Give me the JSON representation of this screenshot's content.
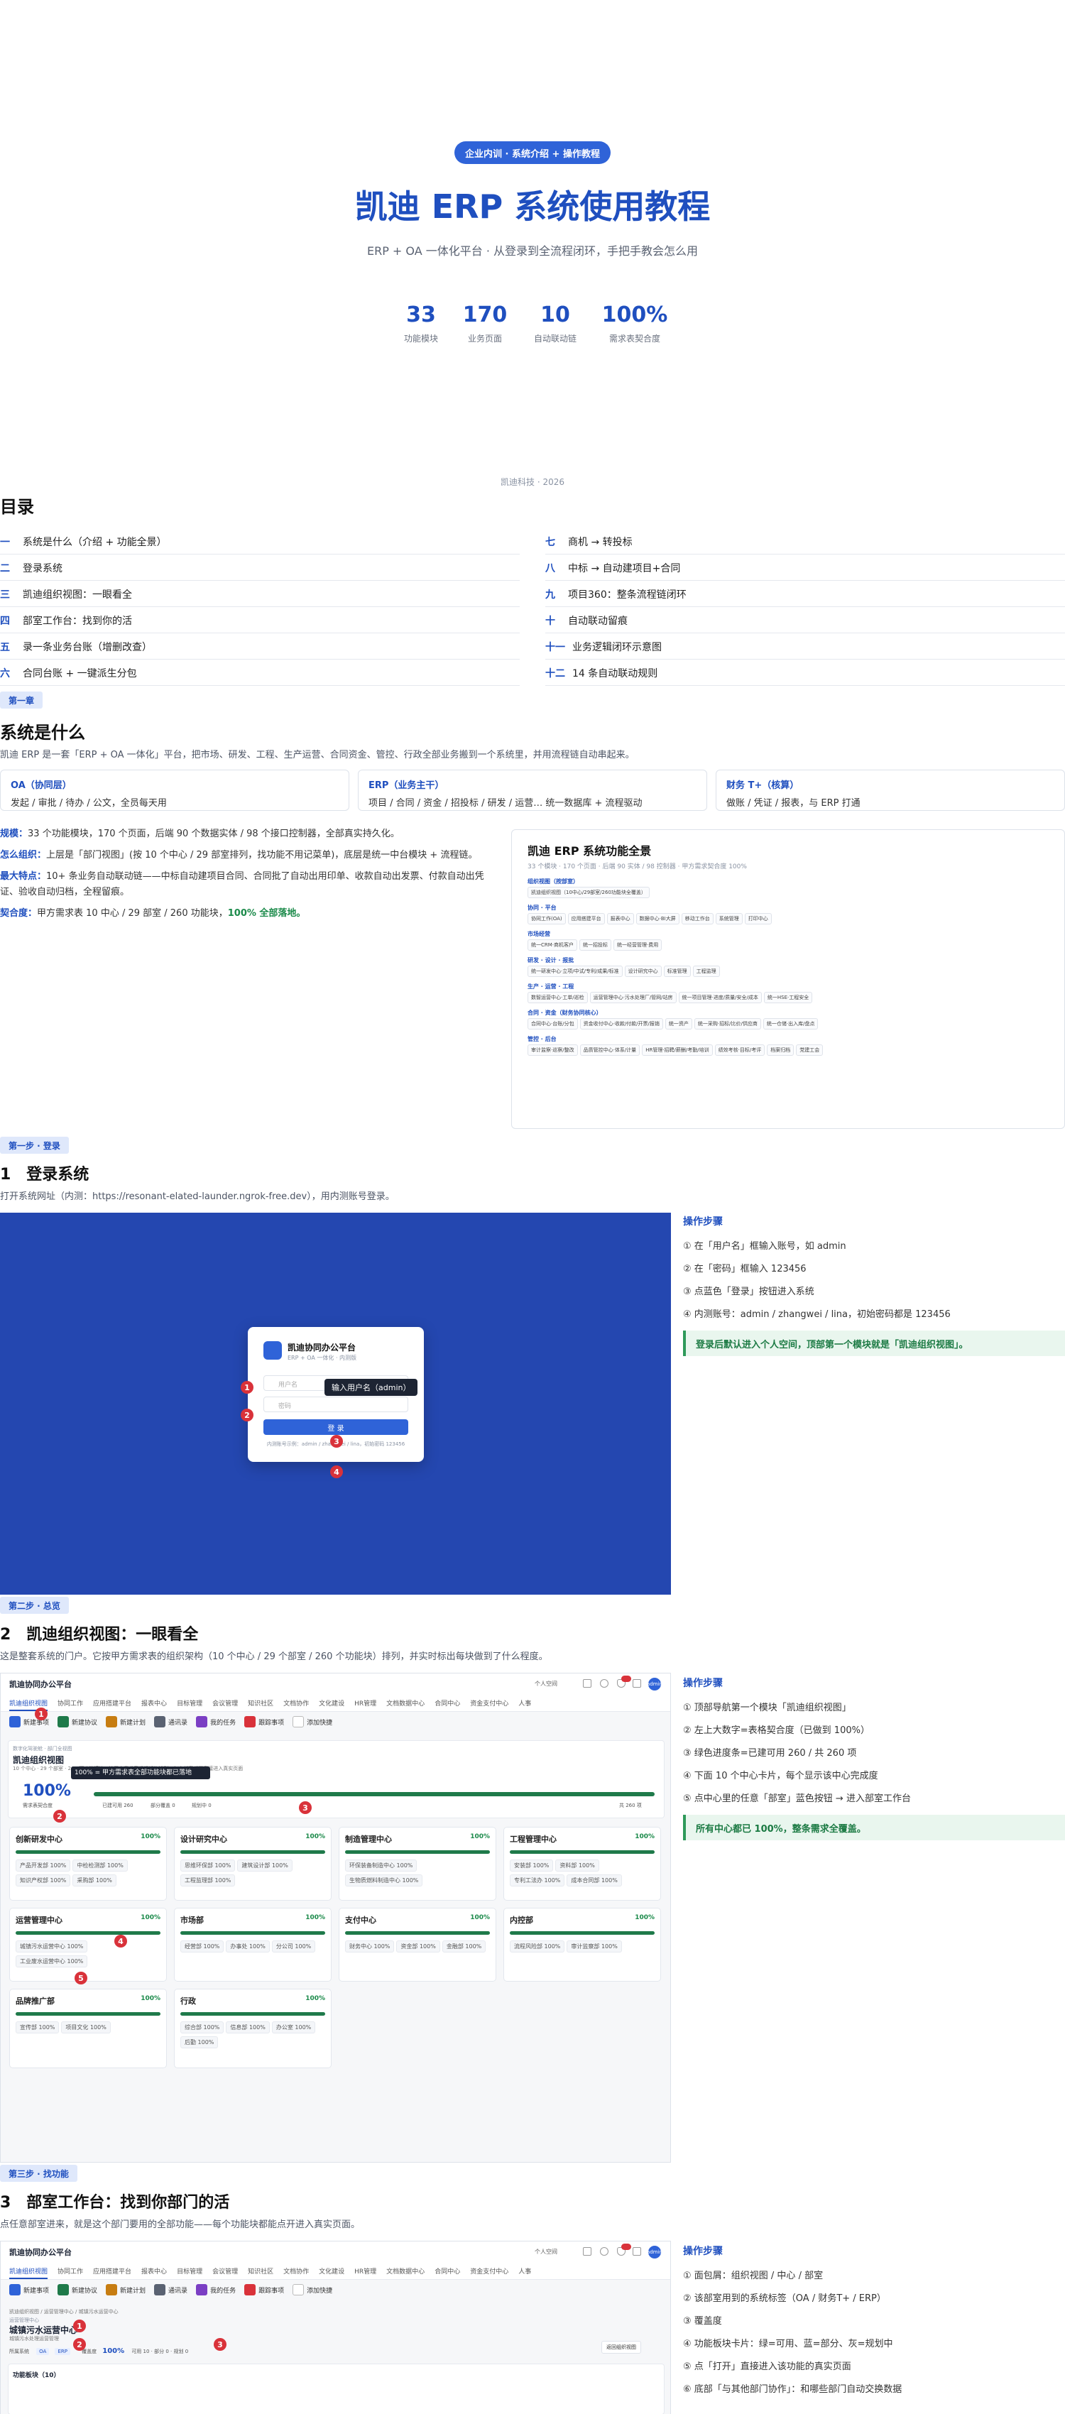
{
  "cover": {
    "tag": "企业内训 · 系统介绍 + 操作教程",
    "title": "凯迪 ERP 系统使用教程",
    "subtitle": "ERP + OA 一体化平台 · 从登录到全流程闭环，手把手教会怎么用",
    "stats": [
      {
        "num": "33",
        "label": "功能模块"
      },
      {
        "num": "170",
        "label": "业务页面"
      },
      {
        "num": "10",
        "label": "自动联动链"
      },
      {
        "num": "100%",
        "label": "需求表契合度"
      }
    ],
    "footer": "凯迪科技 · 2026"
  },
  "toc": {
    "title": "目录",
    "left": [
      {
        "no": "一",
        "text": "系统是什么（介绍 + 功能全景）"
      },
      {
        "no": "二",
        "text": "登录系统"
      },
      {
        "no": "三",
        "text": "凯迪组织视图：一眼看全"
      },
      {
        "no": "四",
        "text": "部室工作台：找到你的活"
      },
      {
        "no": "五",
        "text": "录一条业务台账（增删改查）"
      },
      {
        "no": "六",
        "text": "合同台账 + 一键派生分包"
      }
    ],
    "right": [
      {
        "no": "七",
        "text": "商机 → 转投标"
      },
      {
        "no": "八",
        "text": "中标 → 自动建项目+合同"
      },
      {
        "no": "九",
        "text": "项目360：整条流程链闭环"
      },
      {
        "no": "十",
        "text": "自动联动留痕"
      },
      {
        "no": "十一",
        "text": "业务逻辑闭环示意图"
      },
      {
        "no": "十二",
        "text": "14 条自动联动规则"
      }
    ]
  },
  "ch1": {
    "chip": "第一章",
    "title": "系统是什么",
    "intro": "凯迪 ERP 是一套「ERP + OA 一体化」平台，把市场、研发、工程、生产运营、合同资金、管控、行政全部业务搬到一个系统里，并用流程链自动串起来。",
    "cards": [
      {
        "title": "OA（协同层）",
        "desc": "发起 / 审批 / 待办 / 公文，全员每天用"
      },
      {
        "title": "ERP（业务主干）",
        "desc": "项目 / 合同 / 资金 / 招投标 / 研发 / 运营… 统一数据库 + 流程驱动"
      },
      {
        "title": "财务 T+（核算）",
        "desc": "做账 / 凭证 / 报表，与 ERP 打通"
      }
    ],
    "scale_k": "规模：",
    "scale_v": "33 个功能模块，170 个页面，后端 90 个数据实体 / 98 个接口控制器，全部真实持久化。",
    "org_k": "怎么组织：",
    "org_v": "上层是「部门视图」(按 10 个中心 / 29 部室排列，找功能不用记菜单)，底层是统一中台模块 + 流程链。",
    "feat_k": "最大特点：",
    "feat_v": "10+ 条业务自动联动链——中标自动建项目合同、合同批了自动出用印单、收款自动出发票、付款自动出凭证、验收自动归档，全程留痕。",
    "fit_k": "契合度：",
    "fit_v": "甲方需求表 10 中心 / 29 部室 / 260 功能块，",
    "fit_ok": "100% 全部落地。"
  },
  "panorama": {
    "title": "凯迪 ERP 系统功能全景",
    "meta": "33 个模块 · 170 个页面 · 后端 90 实体 / 98 控制器 · 甲方需求契合度 100%",
    "groups": [
      {
        "name": "组织视图（按部室）",
        "tags": [
          "凯迪组织视图（10中心/29部室/260功能块全覆盖）"
        ]
      },
      {
        "name": "协同 · 平台",
        "tags": [
          "协同工作(OA)",
          "应用搭建平台",
          "报表中心",
          "数据中心·BI大屏",
          "移动工作台",
          "系统管理",
          "打印中心"
        ]
      },
      {
        "name": "市场经营",
        "tags": [
          "统一CRM·商机客户",
          "统一招投标",
          "统一经营管理·费用"
        ]
      },
      {
        "name": "研发 · 设计 · 报批",
        "tags": [
          "统一研发中心·立项/中试/专利/成果/标准",
          "设计研究中心",
          "标准管理",
          "工程监理"
        ]
      },
      {
        "name": "生产 · 运营 · 工程",
        "tags": [
          "数智运营中心·工单/巡检",
          "运营管理中心·污水处理厂/管网/站房",
          "统一项目管理·进度/质量/安全/成本",
          "统一HSE·工程安全"
        ]
      },
      {
        "name": "合同 · 资金（财务协同核心）",
        "tags": [
          "合同中心·台账/分包",
          "资金收付中心·收款/付款/开票/报销",
          "统一资产",
          "统一采购·招标/比价/供应商",
          "统一仓储·出入库/盘点"
        ]
      },
      {
        "name": "管控 · 后台",
        "tags": [
          "审计监察·巡察/整改",
          "品质管控中心·体系/计量",
          "HR管理·招聘/薪酬/考勤/培训",
          "绩效考核·目标/考评",
          "档案归档",
          "党建工会"
        ]
      }
    ]
  },
  "step1": {
    "chip": "第一步 · 登录",
    "title": "1　登录系统",
    "desc": "打开系统网址（内测：https://resonant-elated-launder.ngrok-free.dev），用内测账号登录。",
    "login": {
      "app": "凯迪协同办公平台",
      "app_sub": "ERP + OA 一体化 · 内测版",
      "user_ph": "用户名",
      "pwd_ph": "密码",
      "btn": "登 录",
      "hint": "内测账号示例：admin / zhangwei / lina，初始密码 123456",
      "tooltip": "输入用户名（admin）"
    },
    "steps_title": "操作步骤",
    "steps": [
      "① 在「用户名」框输入账号，如 admin",
      "② 在「密码」框输入 123456",
      "③ 点蓝色「登录」按钮进入系统",
      "④ 内测账号：admin / zhangwei / lina，初始密码都是 123456"
    ],
    "note": "登录后默认进入个人空间，顶部第一个模块就是「凯迪组织视图」。"
  },
  "step2": {
    "chip": "第二步 · 总览",
    "title": "2　凯迪组织视图：一眼看全",
    "desc": "这是整套系统的门户。它按甲方需求表的组织架构（10 个中心 / 29 个部室 / 260 个功能块）排列，并实时标出每块做到了什么程度。",
    "app": "凯迪协同办公平台",
    "top_right": "个人空间",
    "avatar": "admin",
    "tabs": [
      "凯迪组织视图",
      "协同工作",
      "应用搭建平台",
      "报表中心",
      "目标管理",
      "会议管理",
      "知识社区",
      "文档协作",
      "文化建设",
      "HR管理",
      "文档数据中心",
      "合同中心",
      "资金支付中心",
      "人事"
    ],
    "quick": [
      "新建事项",
      "新建协议",
      "新建计划",
      "通讯录",
      "我的任务",
      "跟踪事项",
      "添加快捷"
    ],
    "crumb": "数字化驾驶舱 · 部门全视图",
    "view_title": "凯迪组织视图",
    "view_desc": "10 个中心 · 29 个部室 · 260 项功能模块，按甲方需求表组织架构排列，每个部室都可直接进入真实页面",
    "pct": "100%",
    "pct_label": "需求表契合度",
    "done_label": "已建可用 260",
    "partial_label": "部分覆盖 0",
    "plan_label": "规划中 0",
    "total_label": "共 260 项",
    "tooltip": "100% = 甲方需求表全部功能块都已落地",
    "depts": [
      {
        "name": "创新研发中心",
        "pct": "100%",
        "subs": [
          "产品开发部 100%",
          "中检检测部 100%",
          "知识产权部 100%",
          "采购部 100%"
        ]
      },
      {
        "name": "设计研究中心",
        "pct": "100%",
        "subs": [
          "思维环保部 100%",
          "建筑设计部 100%",
          "工程监理部 100%"
        ]
      },
      {
        "name": "制造管理中心",
        "pct": "100%",
        "subs": [
          "环保装备制造中心 100%",
          "生物质燃料制造中心 100%"
        ]
      },
      {
        "name": "工程管理中心",
        "pct": "100%",
        "subs": [
          "安装部 100%",
          "资料部 100%",
          "专利工法办 100%",
          "成本合同部 100%"
        ]
      },
      {
        "name": "运营管理中心",
        "pct": "100%",
        "subs": [
          "城镇污水运营中心 100%",
          "工业废水运营中心 100%"
        ]
      },
      {
        "name": "市场部",
        "pct": "100%",
        "subs": [
          "经营部 100%",
          "办事处 100%",
          "分公司 100%"
        ]
      },
      {
        "name": "支付中心",
        "pct": "100%",
        "subs": [
          "财务中心 100%",
          "资金部 100%",
          "金融部 100%"
        ]
      },
      {
        "name": "内控部",
        "pct": "100%",
        "subs": [
          "流程风险部 100%",
          "审计监察部 100%"
        ]
      },
      {
        "name": "品牌推广部",
        "pct": "100%",
        "subs": [
          "宣传部 100%",
          "项目文化 100%"
        ]
      },
      {
        "name": "行政",
        "pct": "100%",
        "subs": [
          "综合部 100%",
          "信息部 100%",
          "办公室 100%",
          "后勤 100%"
        ]
      }
    ],
    "steps_title": "操作步骤",
    "steps": [
      "① 顶部导航第一个模块「凯迪组织视图」",
      "② 左上大数字=表格契合度（已做到 100%）",
      "③ 绿色进度条=已建可用 260 / 共 260 项",
      "④ 下面 10 个中心卡片，每个显示该中心完成度",
      "⑤ 点中心里的任意「部室」蓝色按钮 → 进入部室工作台"
    ],
    "note": "所有中心都已 100%，整条需求全覆盖。"
  },
  "step3": {
    "chip": "第三步 · 找功能",
    "title": "3　部室工作台：找到你部门的活",
    "desc": "点任意部室进来，就是这个部门要用的全部功能——每个功能块都能点开进入真实页面。",
    "crumb": "凯迪组织视图 / 运营管理中心 / 城镇污水运营中心",
    "center": "运营管理中心",
    "dept_title": "城镇污水运营中心",
    "dept_desc": "城镇污水处理运营管理",
    "roles": [
      "所属系统",
      "OA",
      "ERP"
    ],
    "cover_label": "覆盖度",
    "cover_pct": "100%",
    "cover_stats": "可用 10 · 部分 0 · 规划 0",
    "back": "返回组织视图",
    "func_title": "功能板块（10）",
    "steps_title": "操作步骤",
    "steps": [
      "① 面包屑：组织视图 / 中心 / 部室",
      "② 该部室用到的系统标签（OA / 财务T+ / ERP）",
      "③ 覆盖度",
      "④ 功能板块卡片：绿=可用、蓝=部分、灰=规划中",
      "⑤ 点「打开」直接进入该功能的真实页面",
      "⑥ 底部「与其他部门协作」：和哪些部门自动交换数据"
    ]
  }
}
